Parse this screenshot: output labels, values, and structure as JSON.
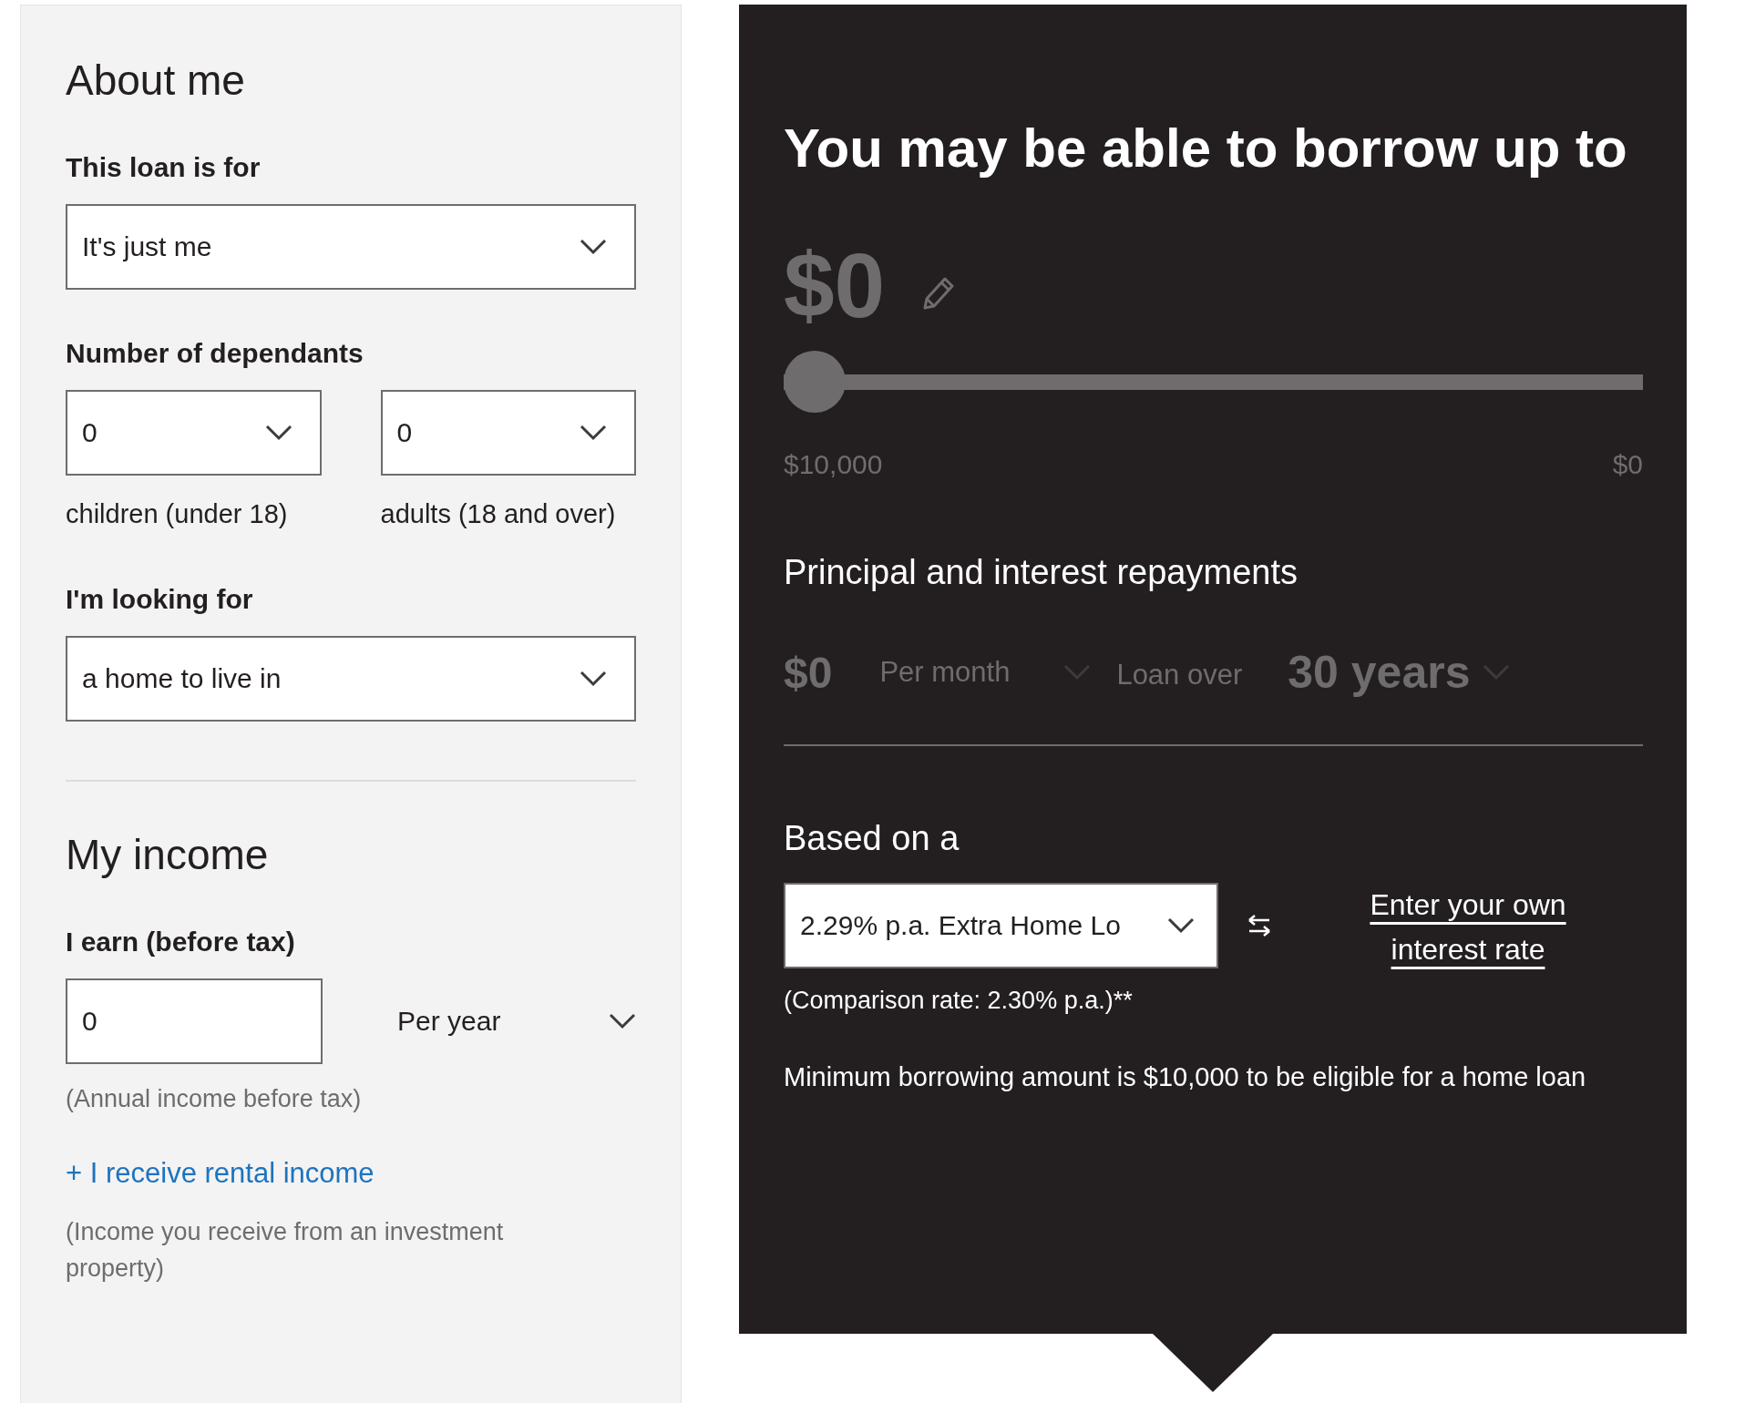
{
  "about_me": {
    "heading": "About me",
    "loan_for": {
      "label": "This loan is for",
      "value": "It's just me"
    },
    "dependants": {
      "label": "Number of dependants",
      "fields": [
        {
          "value": "0",
          "caption": "children (under 18)"
        },
        {
          "value": "0",
          "caption": "adults (18 and over)"
        }
      ]
    },
    "looking_for": {
      "label": "I'm looking for",
      "value": "a home to live in"
    }
  },
  "my_income": {
    "heading": "My income",
    "earn": {
      "label": "I earn (before tax)",
      "value": "0",
      "frequency": "Per year",
      "hint": "(Annual income before tax)"
    },
    "rental_link": "+ I receive rental income",
    "rental_note": "(Income you receive from an investment property)"
  },
  "result": {
    "heading": "You may be able to borrow up to",
    "amount": "$0",
    "slider": {
      "level": 0,
      "min_label": "$10,000",
      "max_label": "$0"
    },
    "repayments": {
      "heading": "Principal and interest repayments",
      "amount": "$0",
      "frequency": "Per month",
      "term_label": "Loan over",
      "term": "30 years"
    },
    "rate": {
      "heading": "Based on a",
      "product": "2.29% p.a. Extra Home Lo",
      "comparison": "(Comparison rate: 2.30% p.a.)**",
      "own_rate_link": "Enter your own interest rate"
    },
    "note": "Minimum borrowing amount is $10,000 to be eligible for a home loan"
  }
}
